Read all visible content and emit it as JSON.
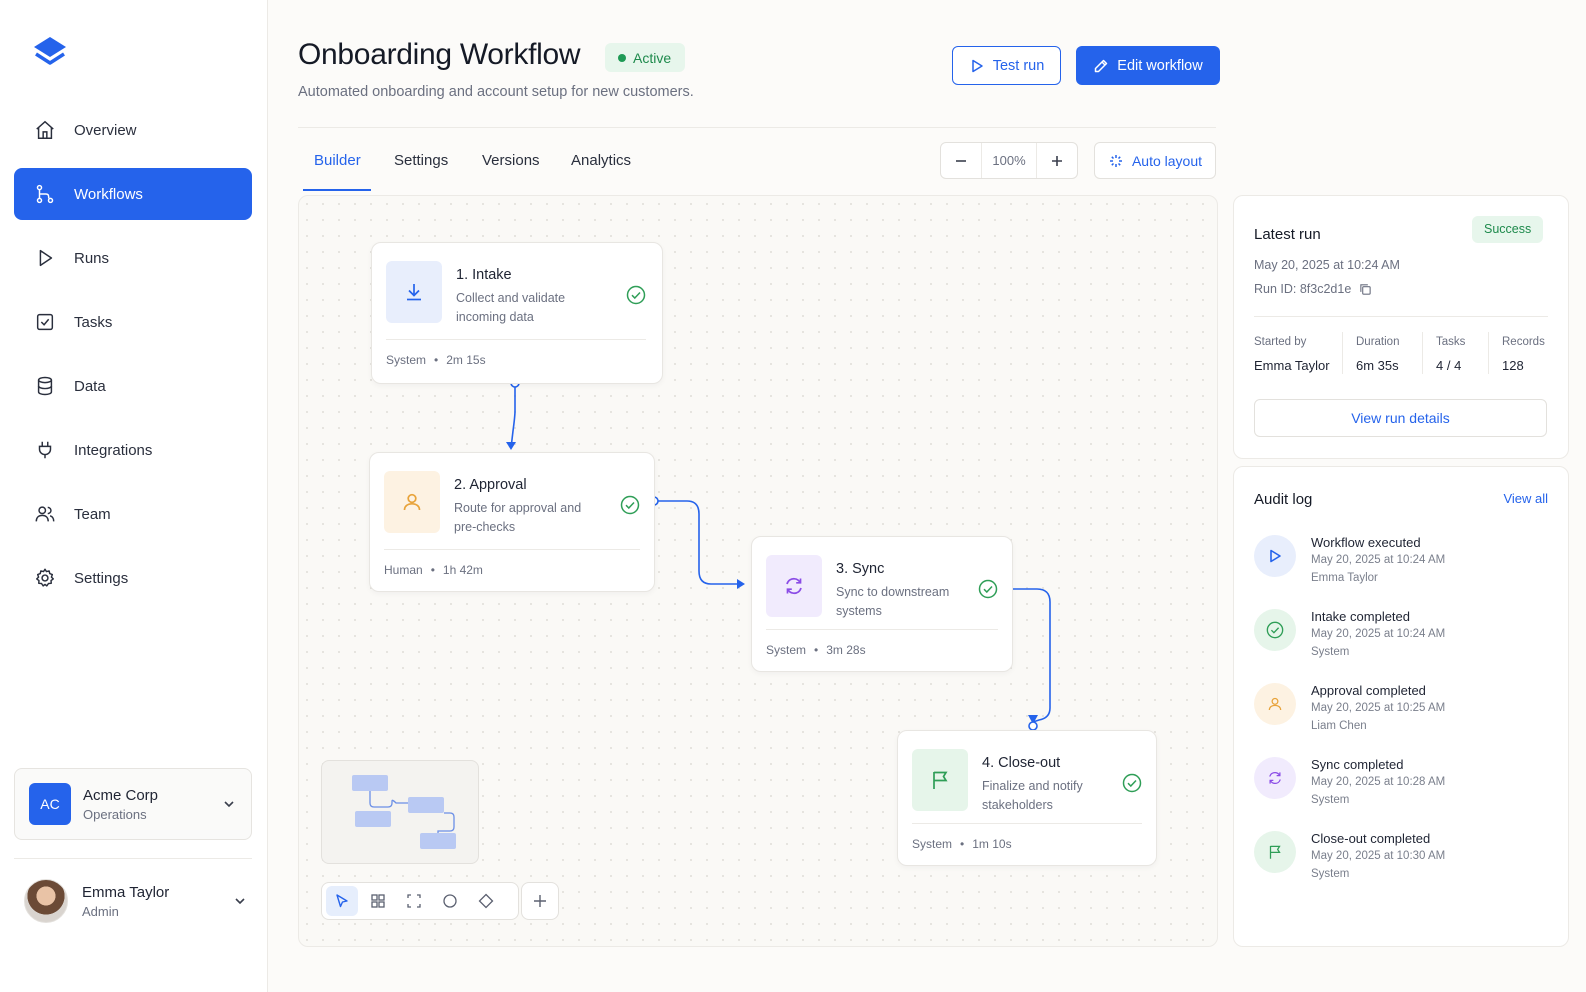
{
  "sidebar": {
    "items": [
      {
        "label": "Overview",
        "icon": "home-icon"
      },
      {
        "label": "Workflows",
        "icon": "workflow-icon",
        "active": true
      },
      {
        "label": "Runs",
        "icon": "play-icon"
      },
      {
        "label": "Tasks",
        "icon": "checkbox-icon"
      },
      {
        "label": "Data",
        "icon": "database-icon"
      },
      {
        "label": "Integrations",
        "icon": "plug-icon"
      },
      {
        "label": "Team",
        "icon": "users-icon"
      },
      {
        "label": "Settings",
        "icon": "gear-icon"
      }
    ],
    "org": {
      "initials": "AC",
      "name": "Acme Corp",
      "sub": "Operations"
    },
    "user": {
      "name": "Emma Taylor",
      "role": "Admin"
    }
  },
  "header": {
    "title": "Onboarding Workflow",
    "status": "Active",
    "subtitle": "Automated onboarding and account setup for new customers.",
    "test_run_label": "Test run",
    "edit_label": "Edit workflow"
  },
  "tabs": [
    {
      "label": "Builder",
      "active": true
    },
    {
      "label": "Settings"
    },
    {
      "label": "Versions"
    },
    {
      "label": "Analytics"
    }
  ],
  "canvas_controls": {
    "zoom": "100%",
    "auto_layout_label": "Auto layout"
  },
  "nodes": [
    {
      "title": "1. Intake",
      "desc": "Collect and validate incoming data",
      "actor": "System",
      "duration": "2m 15s",
      "icon": "download-icon",
      "color": "#e8eefc",
      "icon_color": "#2563eb"
    },
    {
      "title": "2. Approval",
      "desc": "Route for approval and pre-checks",
      "actor": "Human",
      "duration": "1h 42m",
      "icon": "user-icon",
      "color": "#fdf2e2",
      "icon_color": "#e8a33a"
    },
    {
      "title": "3. Sync",
      "desc": "Sync to downstream systems",
      "actor": "System",
      "duration": "3m 28s",
      "icon": "sync-icon",
      "color": "#f1ebfd",
      "icon_color": "#8b4ce6"
    },
    {
      "title": "4. Close-out",
      "desc": "Finalize and notify stakeholders",
      "actor": "System",
      "duration": "1m 10s",
      "icon": "flag-icon",
      "color": "#e6f5ea",
      "icon_color": "#2f9e57"
    }
  ],
  "latest_run": {
    "title": "Latest run",
    "status": "Success",
    "timestamp": "May 20, 2025 at 10:24 AM",
    "run_id": "Run ID: 8f3c2d1e",
    "stats": [
      {
        "label": "Started by",
        "value": "Emma Taylor"
      },
      {
        "label": "Duration",
        "value": "6m 35s"
      },
      {
        "label": "Tasks",
        "value": "4 / 4"
      },
      {
        "label": "Records",
        "value": "128"
      }
    ],
    "details_label": "View run details"
  },
  "audit_log": {
    "title": "Audit log",
    "view_all_label": "View all",
    "items": [
      {
        "title": "Workflow executed",
        "time": "May 20, 2025 at 10:24 AM",
        "by": "Emma Taylor",
        "icon": "play-icon",
        "bg": "#e8eefc",
        "fg": "#2563eb"
      },
      {
        "title": "Intake completed",
        "time": "May 20, 2025 at 10:24 AM",
        "by": "System",
        "icon": "check-circle-icon",
        "bg": "#e6f5ea",
        "fg": "#2f9e57"
      },
      {
        "title": "Approval completed",
        "time": "May 20, 2025 at 10:25 AM",
        "by": "Liam Chen",
        "icon": "user-icon",
        "bg": "#fdf2e2",
        "fg": "#e8a33a"
      },
      {
        "title": "Sync completed",
        "time": "May 20, 2025 at 10:28 AM",
        "by": "System",
        "icon": "sync-icon",
        "bg": "#f1ebfd",
        "fg": "#8b4ce6"
      },
      {
        "title": "Close-out completed",
        "time": "May 20, 2025 at 10:30 AM",
        "by": "System",
        "icon": "flag-icon",
        "bg": "#e6f5ea",
        "fg": "#2f9e57"
      }
    ]
  },
  "colors": {
    "accent": "#2563eb",
    "success": "#1e8a4c"
  }
}
